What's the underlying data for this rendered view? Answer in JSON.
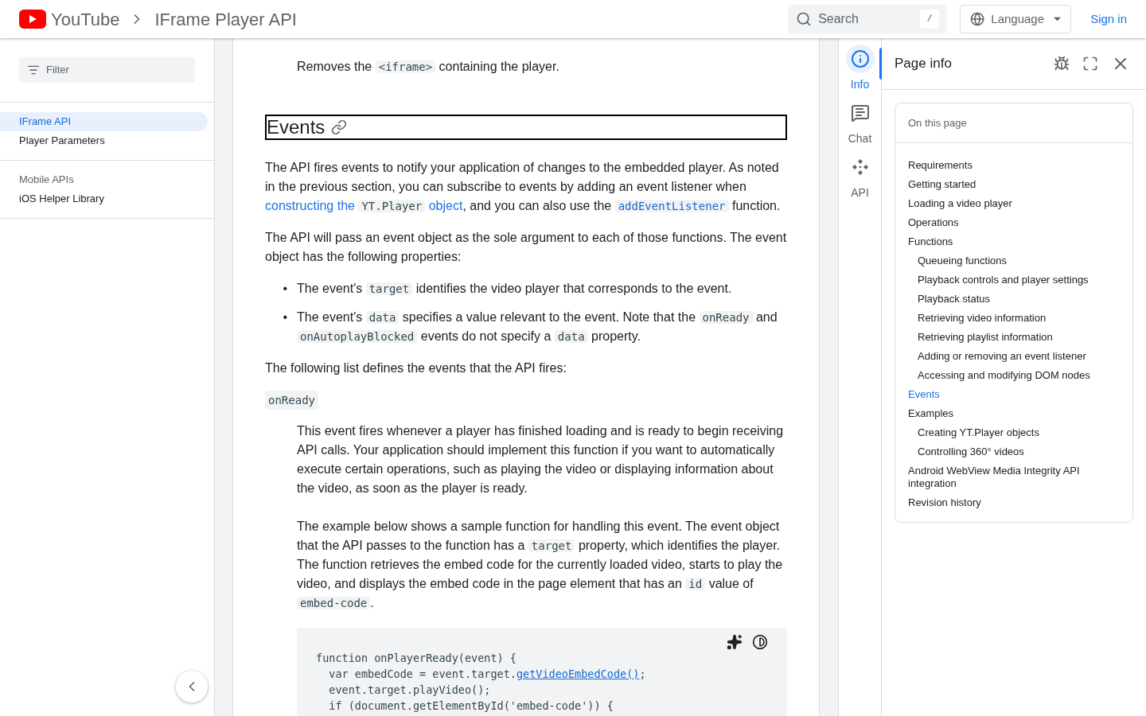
{
  "header": {
    "logo_text": "YouTube",
    "breadcrumb": "IFrame Player API",
    "search": {
      "placeholder": "Search",
      "shortcut": "/"
    },
    "language": "Language",
    "sign_in": "Sign in"
  },
  "sidebar": {
    "filter": {
      "placeholder": "Filter"
    },
    "sections": [
      {
        "items": [
          {
            "label": "IFrame API",
            "selected": true
          },
          {
            "label": "Player Parameters",
            "selected": false
          }
        ]
      },
      {
        "heading": "Mobile APIs",
        "items": [
          {
            "label": "iOS Helper Library",
            "selected": false
          }
        ]
      }
    ]
  },
  "article": {
    "blocks": [
      {
        "kind": "indented",
        "segments": [
          {
            "kind": "text",
            "text": "Removes the "
          },
          {
            "kind": "code",
            "text": "<iframe>"
          },
          {
            "kind": "text",
            "text": " containing the player."
          }
        ]
      },
      {
        "kind": "heading",
        "text": "Events"
      },
      {
        "kind": "paragraph",
        "segments": [
          {
            "kind": "text",
            "text": "The API fires events to notify your application of changes to the embedded player. As noted in the previous section, you can subscribe to events by adding an event listener when "
          },
          {
            "kind": "link",
            "parts": [
              {
                "kind": "text",
                "text": "constructing the "
              },
              {
                "kind": "code",
                "text": "YT.Player"
              },
              {
                "kind": "text",
                "text": " object"
              }
            ]
          },
          {
            "kind": "text",
            "text": ", and you can also use the "
          },
          {
            "kind": "code_link",
            "text": "addEventListener"
          },
          {
            "kind": "text",
            "text": " function."
          }
        ]
      },
      {
        "kind": "paragraph",
        "segments": [
          {
            "kind": "text",
            "text": "The API will pass an event object as the sole argument to each of those functions. The event object has the following properties:"
          }
        ]
      },
      {
        "kind": "bullets",
        "marker": "•",
        "items": [
          [
            {
              "kind": "text",
              "text": "The event's "
            },
            {
              "kind": "code",
              "text": "target"
            },
            {
              "kind": "text",
              "text": " identifies the video player that corresponds to the event."
            }
          ],
          [
            {
              "kind": "text",
              "text": "The event's "
            },
            {
              "kind": "code",
              "text": "data"
            },
            {
              "kind": "text",
              "text": " specifies a value relevant to the event. Note that the "
            },
            {
              "kind": "code",
              "text": "onReady"
            },
            {
              "kind": "text",
              "text": " and "
            },
            {
              "kind": "code",
              "text": "onAutoplayBlocked"
            },
            {
              "kind": "text",
              "text": " events do not specify a "
            },
            {
              "kind": "code",
              "text": "data"
            },
            {
              "kind": "text",
              "text": " property."
            }
          ]
        ]
      },
      {
        "kind": "paragraph",
        "segments": [
          {
            "kind": "text",
            "text": "The following list defines the events that the API fires:"
          }
        ]
      },
      {
        "kind": "term",
        "text": "onReady"
      },
      {
        "kind": "indented",
        "segments": [
          {
            "kind": "text",
            "text": "This event fires whenever a player has finished loading and is ready to begin receiving API calls. Your application should implement this function if you want to automatically execute certain operations, such as playing the video or displaying information about the video, as soon as the player is ready."
          }
        ]
      },
      {
        "kind": "indented",
        "segments": [
          {
            "kind": "text",
            "text": "The example below shows a sample function for handling this event. The event object that the API passes to the function has a "
          },
          {
            "kind": "code",
            "text": "target"
          },
          {
            "kind": "text",
            "text": " property, which identifies the player. The function retrieves the embed code for the currently loaded video, starts to play the video, and displays the embed code in the page element that has an "
          },
          {
            "kind": "code",
            "text": "id"
          },
          {
            "kind": "text",
            "text": " value of "
          },
          {
            "kind": "code",
            "text": "embed-code"
          },
          {
            "kind": "text",
            "text": "."
          }
        ]
      },
      {
        "kind": "code",
        "lines": [
          [
            {
              "kind": "text",
              "text": "function onPlayerReady(event) {"
            }
          ],
          [
            {
              "kind": "text",
              "text": "  var embedCode = event.target."
            },
            {
              "kind": "link",
              "text": "getVideoEmbedCode()"
            },
            {
              "kind": "text",
              "text": ";"
            }
          ],
          [
            {
              "kind": "text",
              "text": "  event.target.playVideo();"
            }
          ],
          [
            {
              "kind": "text",
              "text": "  if (document.getElementById('embed-code')) {"
            }
          ]
        ]
      }
    ]
  },
  "rail": {
    "tabs": [
      {
        "label": "Info",
        "kind": "info",
        "selected": true
      },
      {
        "label": "Chat",
        "kind": "chat",
        "selected": false
      },
      {
        "label": "API",
        "kind": "api",
        "selected": false
      }
    ]
  },
  "page_info": {
    "title": "Page info",
    "toc": {
      "title": "On this page",
      "items": [
        {
          "label": "Requirements",
          "selected": false
        },
        {
          "label": "Getting started",
          "selected": false
        },
        {
          "label": "Loading a video player",
          "selected": false
        },
        {
          "label": "Operations",
          "selected": false
        },
        {
          "label": "Functions",
          "selected": false,
          "children": [
            {
              "label": "Queueing functions",
              "selected": false
            },
            {
              "label": "Playback controls and player settings",
              "selected": false
            },
            {
              "label": "Playback status",
              "selected": false
            },
            {
              "label": "Retrieving video information",
              "selected": false
            },
            {
              "label": "Retrieving playlist information",
              "selected": false
            },
            {
              "label": "Adding or removing an event listener",
              "selected": false
            },
            {
              "label": "Accessing and modifying DOM nodes",
              "selected": false
            }
          ]
        },
        {
          "label": "Events",
          "selected": true
        },
        {
          "label": "Examples",
          "selected": false,
          "children": [
            {
              "label": "Creating YT.Player objects",
              "selected": false
            },
            {
              "label": "Controlling 360° videos",
              "selected": false
            }
          ]
        },
        {
          "label": "Android WebView Media Integrity API integration",
          "selected": false
        },
        {
          "label": "Revision history",
          "selected": false
        }
      ]
    }
  }
}
